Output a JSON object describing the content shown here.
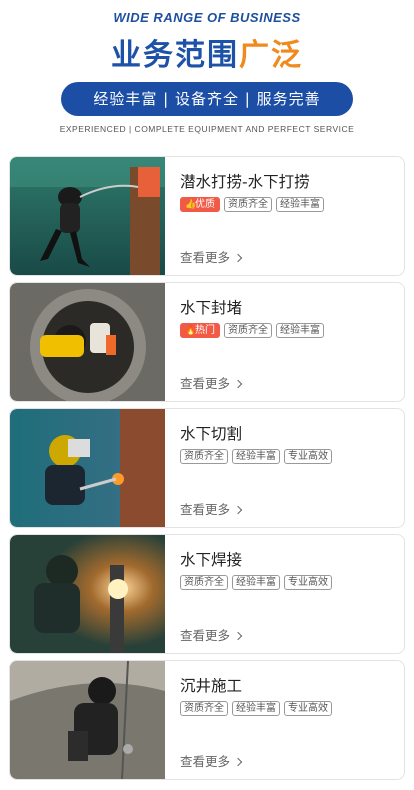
{
  "header": {
    "eyebrow": "WIDE RANGE OF BUSINESS",
    "title_blue": "业务范围",
    "title_orange": "广泛",
    "pill_text": "经验丰富 | 设备齐全 | 服务完善",
    "subline": "EXPERIENCED | COMPLETE EQUIPMENT AND PERFECT SERVICE"
  },
  "services": [
    {
      "title": "潜水打捞-水下打捞",
      "badge": "优质",
      "badge_icon": "thumbs-up-icon",
      "tags": [
        "资质齐全",
        "经验丰富"
      ],
      "more": "查看更多",
      "image": "diver-descending"
    },
    {
      "title": "水下封堵",
      "badge": "热门",
      "badge_icon": "flame-icon",
      "tags": [
        "资质齐全",
        "经验丰富"
      ],
      "more": "查看更多",
      "image": "diver-in-manhole"
    },
    {
      "title": "水下切割",
      "badge": "",
      "tags": [
        "资质齐全",
        "经验丰富",
        "专业高效"
      ],
      "more": "查看更多",
      "image": "underwater-cutting"
    },
    {
      "title": "水下焊接",
      "badge": "",
      "tags": [
        "资质齐全",
        "经验丰富",
        "专业高效"
      ],
      "more": "查看更多",
      "image": "underwater-welding"
    },
    {
      "title": "沉井施工",
      "badge": "",
      "tags": [
        "资质齐全",
        "经验丰富",
        "专业高效"
      ],
      "more": "查看更多",
      "image": "caisson-worker"
    }
  ],
  "colors": {
    "brand_blue": "#1c4ea6",
    "accent_orange": "#f08a1c",
    "badge_red": "#f05a46"
  }
}
